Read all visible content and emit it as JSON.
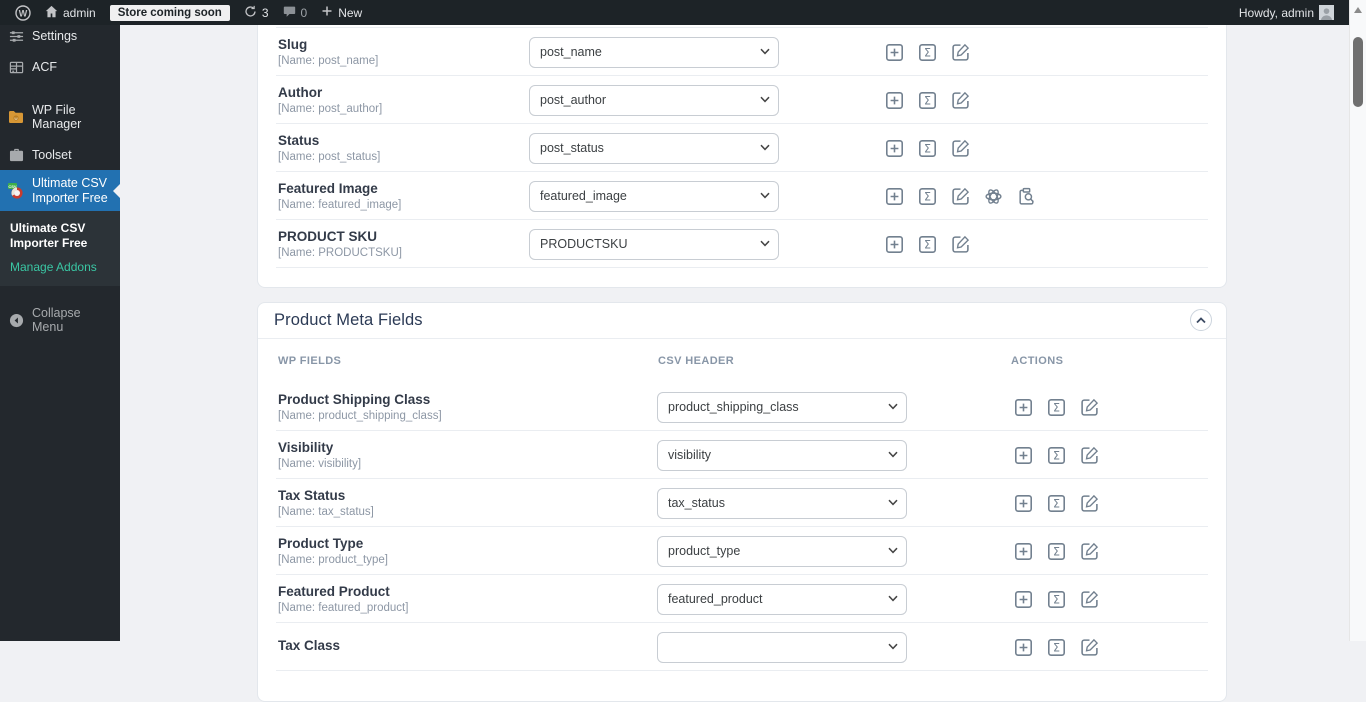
{
  "colors": {
    "accent": "#2271b1",
    "admin_bar_bg": "#1d2327",
    "sidebar_bg": "#23282d",
    "submenu_link_teal": "#3ac7a4",
    "content_bg": "#f0f1f4",
    "action_icon": "#72808f"
  },
  "admin_bar": {
    "site_name": "admin",
    "store_status": "Store coming soon",
    "update_count": "3",
    "comment_count": "0",
    "new_label": "New",
    "howdy": "Howdy, admin"
  },
  "sidebar": {
    "items": [
      {
        "label": "Settings",
        "icon": "sliders-icon"
      },
      {
        "label": "ACF",
        "icon": "table-icon"
      },
      {
        "label": "WP File Manager",
        "icon": "folder-icon"
      },
      {
        "label": "Toolset",
        "icon": "briefcase-icon"
      },
      {
        "label": "Ultimate CSV Importer Free",
        "icon": "csv-importer-icon",
        "active": true
      }
    ],
    "submenu": [
      {
        "label": "Ultimate CSV Importer Free",
        "current": true
      },
      {
        "label": "Manage Addons",
        "current": false
      }
    ],
    "collapse_label": "Collapse Menu"
  },
  "post_fields_section": {
    "rows": [
      {
        "label": "Slug",
        "name": "[Name: post_name]",
        "csv_header": "post_name"
      },
      {
        "label": "Author",
        "name": "[Name: post_author]",
        "csv_header": "post_author"
      },
      {
        "label": "Status",
        "name": "[Name: post_status]",
        "csv_header": "post_status"
      },
      {
        "label": "Featured Image",
        "name": "[Name: featured_image]",
        "csv_header": "featured_image",
        "extra_actions": true
      },
      {
        "label": "PRODUCT SKU",
        "name": "[Name: PRODUCTSKU]",
        "csv_header": "PRODUCTSKU"
      }
    ]
  },
  "meta_section": {
    "title": "Product Meta Fields",
    "columns": [
      "WP FIELDS",
      "CSV HEADER",
      "ACTIONS"
    ],
    "rows": [
      {
        "label": "Product Shipping Class",
        "name": "[Name: product_shipping_class]",
        "csv_header": "product_shipping_class"
      },
      {
        "label": "Visibility",
        "name": "[Name: visibility]",
        "csv_header": "visibility"
      },
      {
        "label": "Tax Status",
        "name": "[Name: tax_status]",
        "csv_header": "tax_status"
      },
      {
        "label": "Product Type",
        "name": "[Name: product_type]",
        "csv_header": "product_type"
      },
      {
        "label": "Featured Product",
        "name": "[Name: featured_product]",
        "csv_header": "featured_product"
      },
      {
        "label": "Tax Class",
        "name": "",
        "csv_header": ""
      }
    ]
  },
  "icons": {
    "row_actions": [
      "plus-square",
      "sigma-formula",
      "edit-pencil",
      "ai-generate",
      "media-search"
    ]
  }
}
